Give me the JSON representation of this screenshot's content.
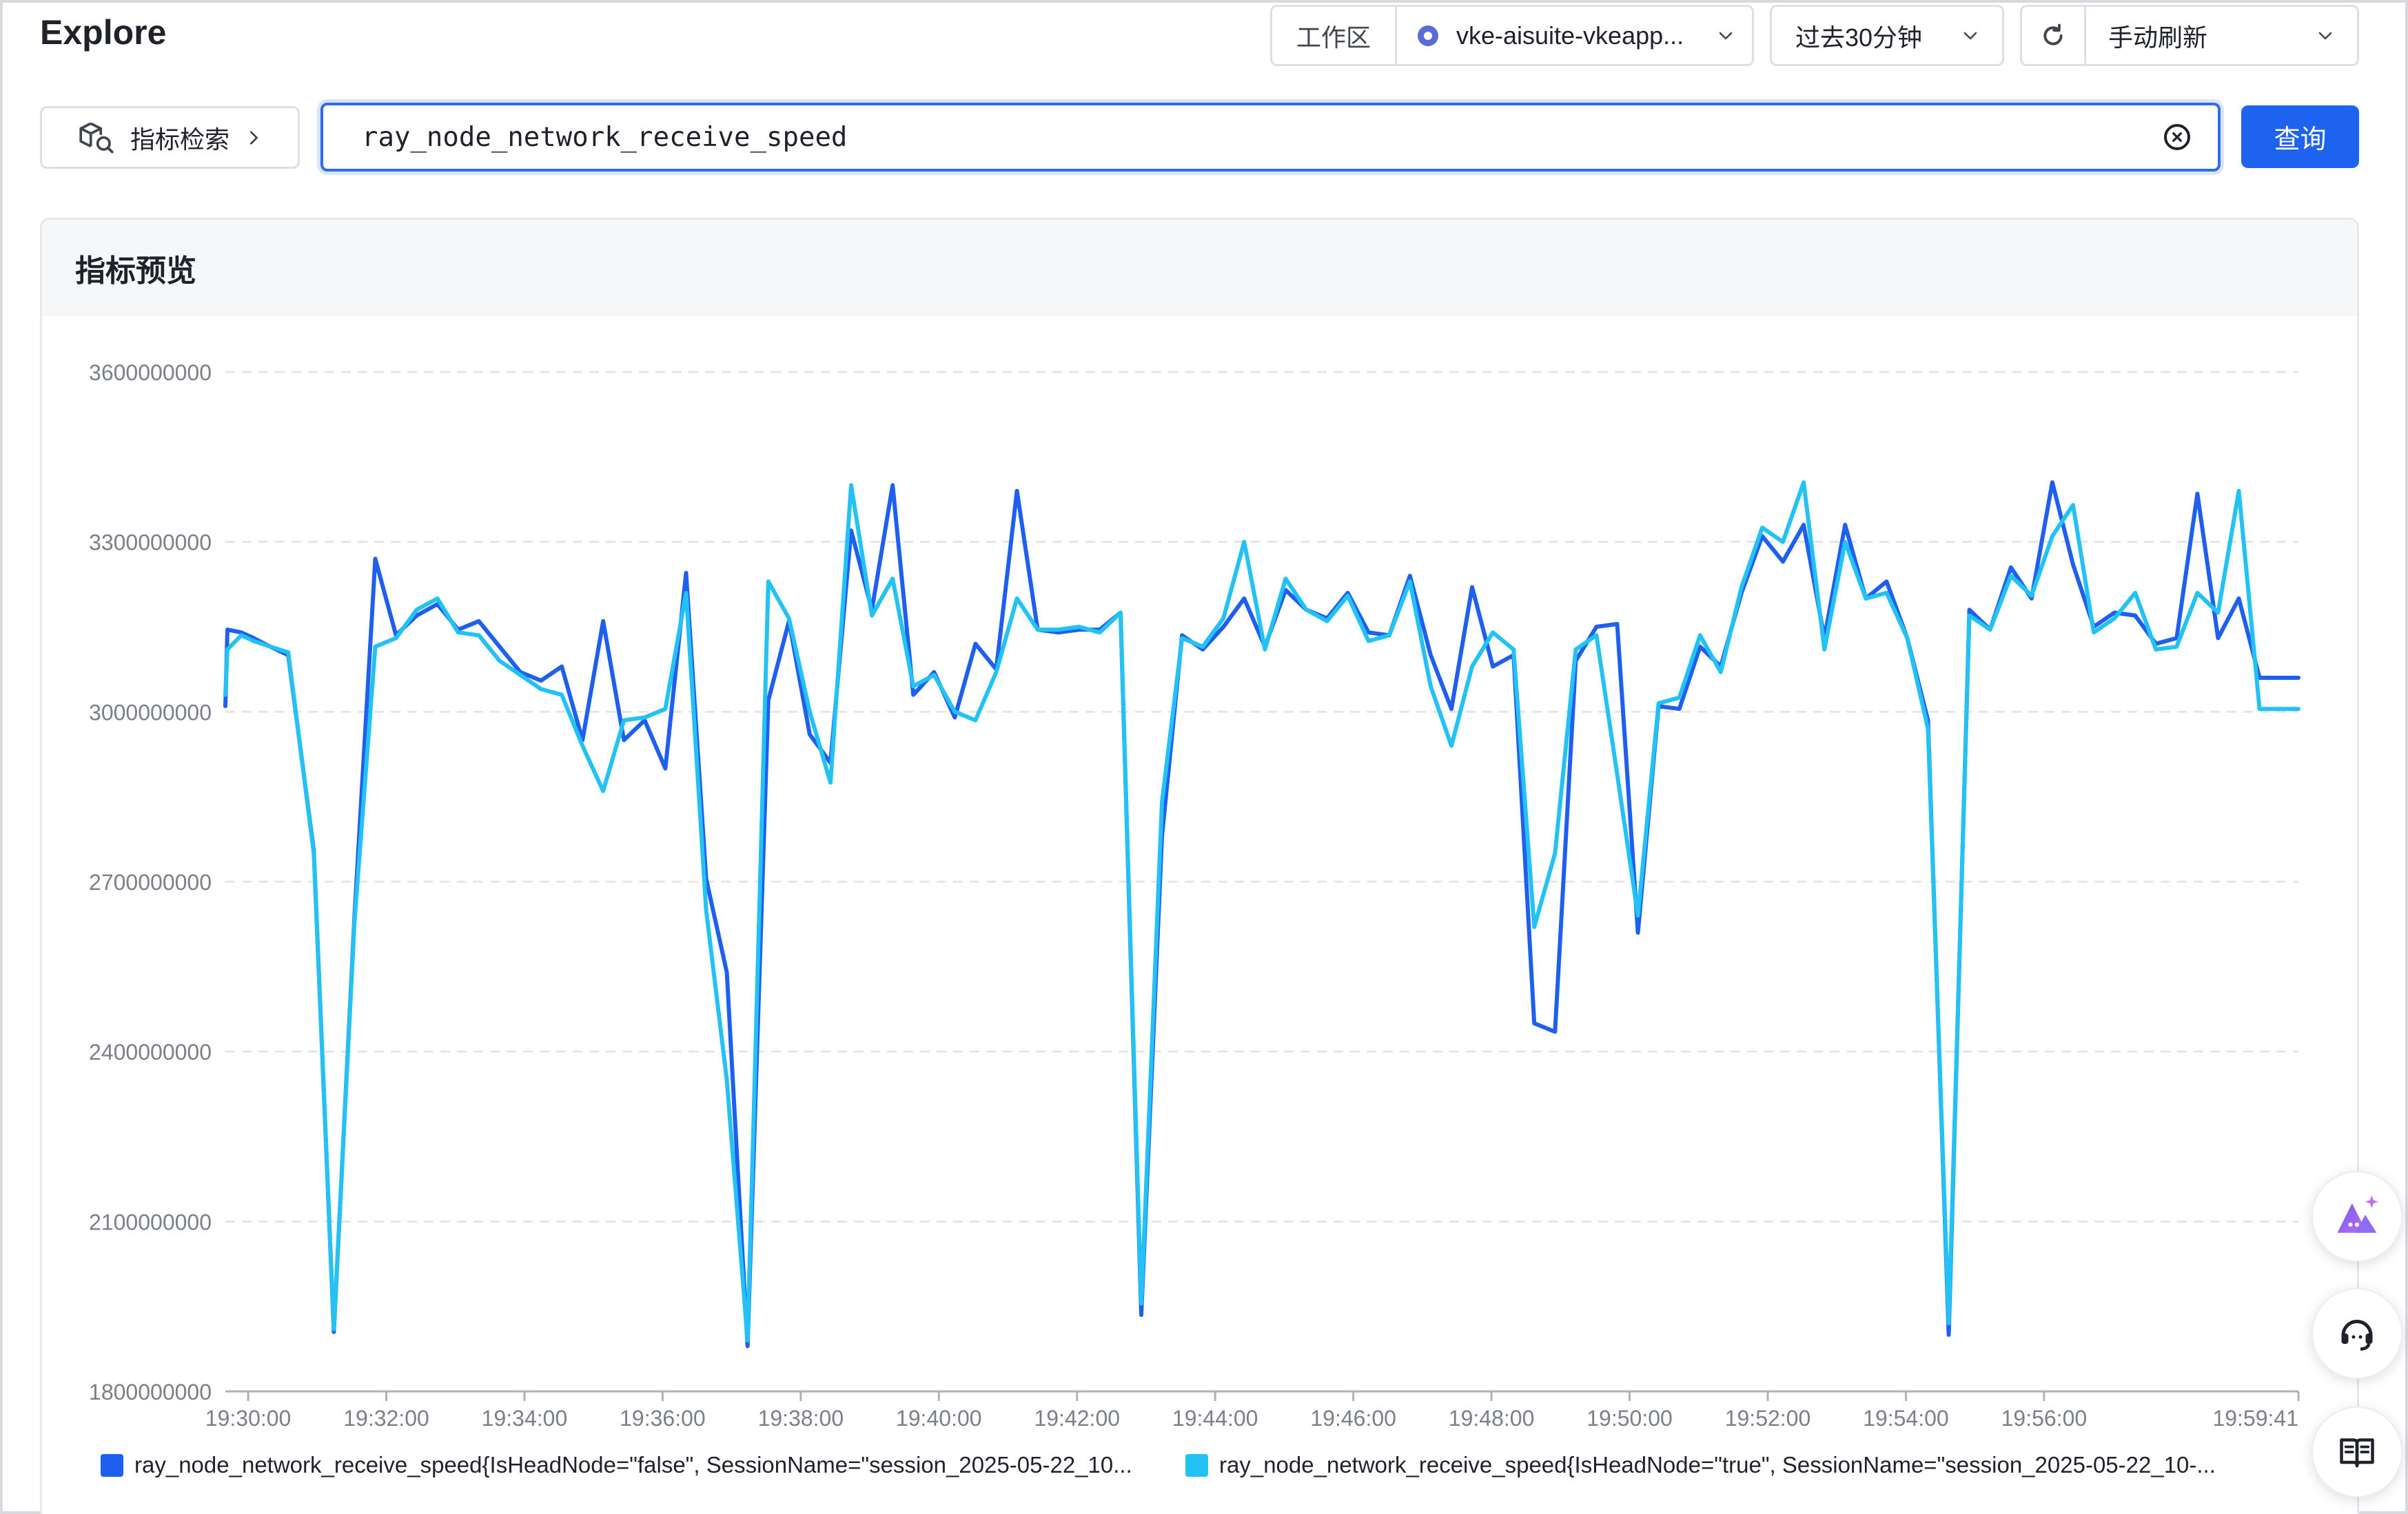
{
  "header": {
    "title": "Explore",
    "workspace_label": "工作区",
    "workspace_value": "vke-aisuite-vkeapp...",
    "time_range": "过去30分钟",
    "refresh_mode": "手动刷新"
  },
  "search": {
    "metric_button_label": "指标检索",
    "query": "ray_node_network_receive_speed",
    "submit_label": "查询"
  },
  "panel": {
    "title": "指标预览"
  },
  "chart_data": {
    "type": "line",
    "title": "",
    "xlabel": "",
    "ylabel": "",
    "ylim": [
      1800000000,
      3600000000
    ],
    "yticks": [
      3600000000,
      3300000000,
      3000000000,
      2700000000,
      2400000000,
      2100000000,
      1800000000
    ],
    "xticks": [
      "19:30:00",
      "19:32:00",
      "19:34:00",
      "19:36:00",
      "19:38:00",
      "19:40:00",
      "19:42:00",
      "19:44:00",
      "19:46:00",
      "19:48:00",
      "19:50:00",
      "19:52:00",
      "19:54:00",
      "19:56:00",
      "19:59:41"
    ],
    "xtick_minutes": [
      0,
      2,
      4,
      6,
      8,
      10,
      12,
      14,
      16,
      18,
      20,
      22,
      24,
      26,
      29.683
    ],
    "x_range_minutes": [
      -0.33,
      29.683
    ],
    "x_unit": "minutes after 19:30:00",
    "grid": true,
    "legend_position": "bottom",
    "series": [
      {
        "name": "ray_node_network_receive_speed{IsHeadNode=\"false\", SessionName=\"session_2025-05-22_10...",
        "color": "#1f5ff0",
        "x": [
          -0.33,
          -0.3,
          -0.1,
          0.08,
          0.32,
          0.58,
          0.95,
          1.24,
          1.54,
          1.84,
          2.14,
          2.44,
          2.74,
          3.04,
          3.34,
          3.64,
          3.94,
          4.24,
          4.54,
          4.84,
          5.14,
          5.44,
          5.74,
          6.04,
          6.34,
          6.63,
          6.93,
          7.23,
          7.53,
          7.83,
          8.13,
          8.43,
          8.73,
          9.03,
          9.33,
          9.63,
          9.93,
          10.23,
          10.53,
          10.83,
          11.13,
          11.43,
          11.73,
          12.03,
          12.33,
          12.63,
          12.93,
          13.23,
          13.52,
          13.82,
          14.12,
          14.42,
          14.72,
          15.02,
          15.32,
          15.62,
          15.92,
          16.22,
          16.52,
          16.82,
          17.12,
          17.42,
          17.72,
          18.02,
          18.32,
          18.62,
          18.92,
          19.22,
          19.52,
          19.82,
          20.12,
          20.42,
          20.72,
          21.02,
          21.32,
          21.62,
          21.92,
          22.22,
          22.52,
          22.82,
          23.12,
          23.42,
          23.72,
          24.02,
          24.32,
          24.62,
          24.92,
          25.22,
          25.52,
          25.82,
          26.12,
          26.42,
          26.72,
          27.02,
          27.32,
          27.62,
          27.92,
          28.22,
          28.52,
          28.82,
          29.12,
          29.42,
          29.683
        ],
        "y": [
          3010000000,
          3145000000,
          3140000000,
          3130000000,
          3115000000,
          3100000000,
          2755000000,
          1905000000,
          2640000000,
          3270000000,
          3135000000,
          3170000000,
          3190000000,
          3145000000,
          3160000000,
          3115000000,
          3070000000,
          3055000000,
          3080000000,
          2950000000,
          3160000000,
          2950000000,
          2985000000,
          2900000000,
          3245000000,
          2705000000,
          2540000000,
          1880000000,
          3020000000,
          3160000000,
          2960000000,
          2910000000,
          3320000000,
          3180000000,
          3400000000,
          3030000000,
          3070000000,
          2990000000,
          3120000000,
          3075000000,
          3390000000,
          3145000000,
          3140000000,
          3145000000,
          3145000000,
          3175000000,
          1935000000,
          2780000000,
          3135000000,
          3110000000,
          3150000000,
          3200000000,
          3115000000,
          3215000000,
          3180000000,
          3165000000,
          3210000000,
          3140000000,
          3135000000,
          3240000000,
          3100000000,
          3005000000,
          3220000000,
          3080000000,
          3100000000,
          2450000000,
          2435000000,
          3090000000,
          3150000000,
          3155000000,
          2610000000,
          3010000000,
          3005000000,
          3115000000,
          3080000000,
          3210000000,
          3310000000,
          3265000000,
          3330000000,
          3130000000,
          3330000000,
          3200000000,
          3230000000,
          3130000000,
          2985000000,
          1900000000,
          3180000000,
          3145000000,
          3255000000,
          3200000000,
          3405000000,
          3260000000,
          3150000000,
          3175000000,
          3170000000,
          3120000000,
          3130000000,
          3385000000,
          3130000000,
          3200000000,
          3060000000,
          3060000000,
          3060000000
        ]
      },
      {
        "name": "ray_node_network_receive_speed{IsHeadNode=\"true\", SessionName=\"session_2025-05-22_10-...",
        "color": "#22c2f5",
        "x": [
          -0.33,
          -0.3,
          -0.1,
          0.08,
          0.32,
          0.58,
          0.95,
          1.24,
          1.54,
          1.84,
          2.14,
          2.44,
          2.74,
          3.04,
          3.34,
          3.64,
          3.94,
          4.24,
          4.54,
          4.84,
          5.14,
          5.44,
          5.74,
          6.04,
          6.34,
          6.63,
          6.93,
          7.23,
          7.53,
          7.83,
          8.13,
          8.43,
          8.73,
          9.03,
          9.33,
          9.63,
          9.93,
          10.23,
          10.53,
          10.83,
          11.13,
          11.43,
          11.73,
          12.03,
          12.33,
          12.63,
          12.93,
          13.23,
          13.52,
          13.82,
          14.12,
          14.42,
          14.72,
          15.02,
          15.32,
          15.62,
          15.92,
          16.22,
          16.52,
          16.82,
          17.12,
          17.42,
          17.72,
          18.02,
          18.32,
          18.62,
          18.92,
          19.22,
          19.52,
          19.82,
          20.12,
          20.42,
          20.72,
          21.02,
          21.32,
          21.62,
          21.92,
          22.22,
          22.52,
          22.82,
          23.12,
          23.42,
          23.72,
          24.02,
          24.32,
          24.62,
          24.92,
          25.22,
          25.52,
          25.82,
          26.12,
          26.42,
          26.72,
          27.02,
          27.32,
          27.62,
          27.92,
          28.22,
          28.52,
          28.82,
          29.12,
          29.42,
          29.683
        ],
        "y": [
          3030000000,
          3110000000,
          3135000000,
          3125000000,
          3115000000,
          3105000000,
          2750000000,
          1910000000,
          2630000000,
          3115000000,
          3130000000,
          3180000000,
          3200000000,
          3140000000,
          3135000000,
          3090000000,
          3065000000,
          3040000000,
          3030000000,
          2940000000,
          2860000000,
          2985000000,
          2990000000,
          3005000000,
          3210000000,
          2650000000,
          2350000000,
          1890000000,
          3230000000,
          3165000000,
          3000000000,
          2875000000,
          3400000000,
          3170000000,
          3235000000,
          3045000000,
          3065000000,
          3000000000,
          2985000000,
          3070000000,
          3200000000,
          3145000000,
          3145000000,
          3150000000,
          3140000000,
          3175000000,
          1955000000,
          2840000000,
          3130000000,
          3115000000,
          3165000000,
          3300000000,
          3110000000,
          3235000000,
          3180000000,
          3160000000,
          3205000000,
          3125000000,
          3135000000,
          3230000000,
          3045000000,
          2940000000,
          3080000000,
          3140000000,
          3110000000,
          2620000000,
          2750000000,
          3110000000,
          3135000000,
          2890000000,
          2640000000,
          3015000000,
          3025000000,
          3135000000,
          3070000000,
          3220000000,
          3325000000,
          3300000000,
          3405000000,
          3110000000,
          3300000000,
          3200000000,
          3210000000,
          3130000000,
          2970000000,
          1920000000,
          3170000000,
          3145000000,
          3240000000,
          3205000000,
          3310000000,
          3365000000,
          3140000000,
          3165000000,
          3210000000,
          3110000000,
          3115000000,
          3210000000,
          3175000000,
          3390000000,
          3005000000,
          3005000000,
          3005000000
        ]
      }
    ]
  },
  "floating_actions": {
    "ai_assistant": "ai-assistant",
    "support": "support",
    "docs": "docs"
  }
}
